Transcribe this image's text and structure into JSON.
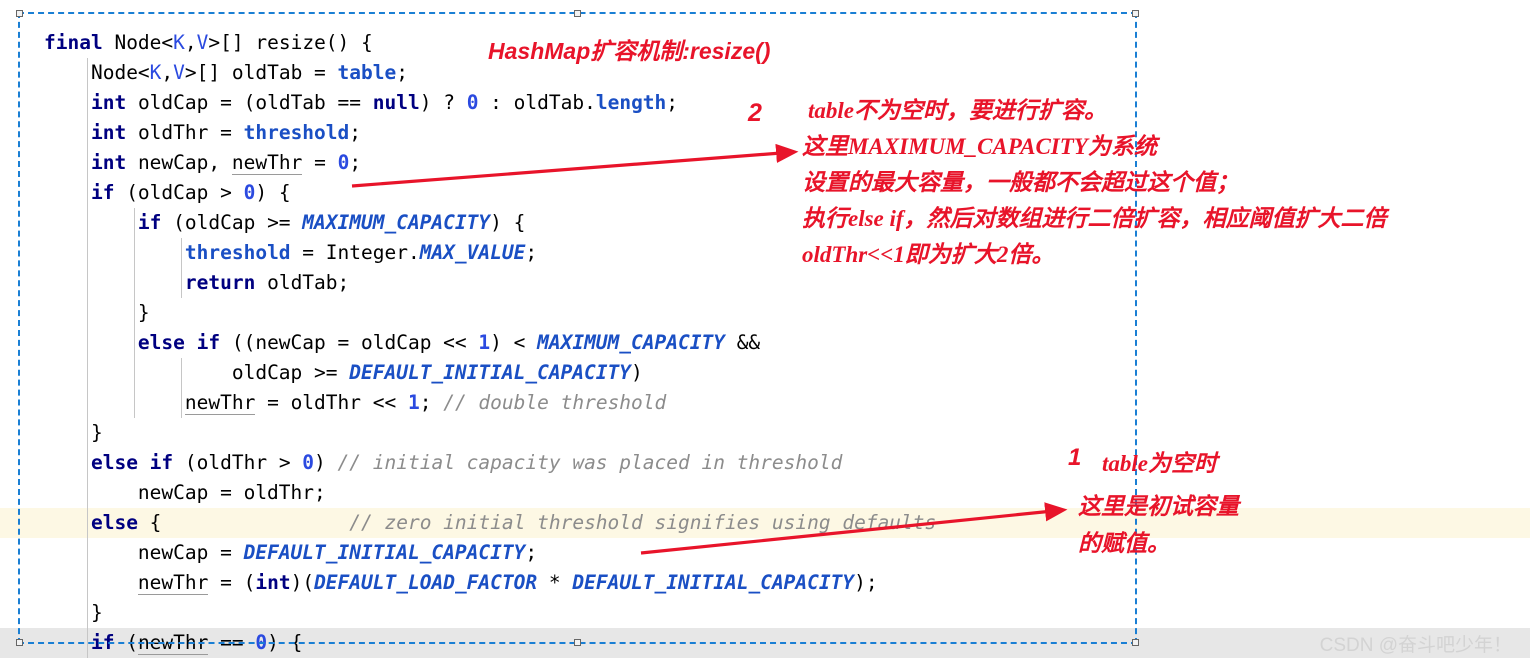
{
  "editor": {
    "language": "java",
    "selection_border_color": "#1a7fd4",
    "highlight_line_color": "#fdf8e4",
    "code_lines": [
      {
        "indent": 0,
        "tokens": [
          {
            "t": "final",
            "c": "kw"
          },
          {
            "t": " ",
            "c": "plain"
          },
          {
            "t": "Node<",
            "c": "plain"
          },
          {
            "t": "K",
            "c": "gen"
          },
          {
            "t": ",",
            "c": "plain"
          },
          {
            "t": "V",
            "c": "gen"
          },
          {
            "t": ">[] resize() {",
            "c": "plain"
          }
        ]
      },
      {
        "indent": 1,
        "tokens": [
          {
            "t": "Node<",
            "c": "plain"
          },
          {
            "t": "K",
            "c": "gen"
          },
          {
            "t": ",",
            "c": "plain"
          },
          {
            "t": "V",
            "c": "gen"
          },
          {
            "t": ">[] oldTab = ",
            "c": "plain"
          },
          {
            "t": "table",
            "c": "field"
          },
          {
            "t": ";",
            "c": "plain"
          }
        ]
      },
      {
        "indent": 1,
        "tokens": [
          {
            "t": "int",
            "c": "kw"
          },
          {
            "t": " oldCap = (oldTab == ",
            "c": "plain"
          },
          {
            "t": "null",
            "c": "kw"
          },
          {
            "t": ") ? ",
            "c": "plain"
          },
          {
            "t": "0",
            "c": "num"
          },
          {
            "t": " : oldTab.",
            "c": "plain"
          },
          {
            "t": "length",
            "c": "field"
          },
          {
            "t": ";",
            "c": "plain"
          }
        ]
      },
      {
        "indent": 1,
        "tokens": [
          {
            "t": "int",
            "c": "kw"
          },
          {
            "t": " oldThr = ",
            "c": "plain"
          },
          {
            "t": "threshold",
            "c": "field"
          },
          {
            "t": ";",
            "c": "plain"
          }
        ]
      },
      {
        "indent": 1,
        "tokens": [
          {
            "t": "int",
            "c": "kw"
          },
          {
            "t": " newCap, ",
            "c": "plain"
          },
          {
            "t": "newThr",
            "c": "warnvar"
          },
          {
            "t": " = ",
            "c": "plain"
          },
          {
            "t": "0",
            "c": "num"
          },
          {
            "t": ";",
            "c": "plain"
          }
        ]
      },
      {
        "indent": 1,
        "tokens": [
          {
            "t": "if",
            "c": "kw"
          },
          {
            "t": " (oldCap > ",
            "c": "plain"
          },
          {
            "t": "0",
            "c": "num"
          },
          {
            "t": ") {",
            "c": "plain"
          }
        ]
      },
      {
        "indent": 2,
        "tokens": [
          {
            "t": "if",
            "c": "kw"
          },
          {
            "t": " (oldCap >= ",
            "c": "plain"
          },
          {
            "t": "MAXIMUM_CAPACITY",
            "c": "const"
          },
          {
            "t": ") {",
            "c": "plain"
          }
        ]
      },
      {
        "indent": 3,
        "tokens": [
          {
            "t": "threshold",
            "c": "field"
          },
          {
            "t": " = Integer.",
            "c": "plain"
          },
          {
            "t": "MAX_VALUE",
            "c": "const"
          },
          {
            "t": ";",
            "c": "plain"
          }
        ]
      },
      {
        "indent": 3,
        "tokens": [
          {
            "t": "return",
            "c": "kw"
          },
          {
            "t": " oldTab;",
            "c": "plain"
          }
        ]
      },
      {
        "indent": 2,
        "tokens": [
          {
            "t": "}",
            "c": "plain"
          }
        ]
      },
      {
        "indent": 2,
        "tokens": [
          {
            "t": "else if",
            "c": "kw"
          },
          {
            "t": " ((newCap = oldCap << ",
            "c": "plain"
          },
          {
            "t": "1",
            "c": "num"
          },
          {
            "t": ") < ",
            "c": "plain"
          },
          {
            "t": "MAXIMUM_CAPACITY",
            "c": "const"
          },
          {
            "t": " &&",
            "c": "plain"
          }
        ]
      },
      {
        "indent": 4,
        "tokens": [
          {
            "t": "oldCap >= ",
            "c": "plain"
          },
          {
            "t": "DEFAULT_INITIAL_CAPACITY",
            "c": "const"
          },
          {
            "t": ")",
            "c": "plain"
          }
        ]
      },
      {
        "indent": 3,
        "tokens": [
          {
            "t": "newThr",
            "c": "warnvar"
          },
          {
            "t": " = oldThr << ",
            "c": "plain"
          },
          {
            "t": "1",
            "c": "num"
          },
          {
            "t": "; ",
            "c": "plain"
          },
          {
            "t": "// double threshold",
            "c": "cmt"
          }
        ]
      },
      {
        "indent": 1,
        "tokens": [
          {
            "t": "}",
            "c": "plain"
          }
        ]
      },
      {
        "indent": 1,
        "tokens": [
          {
            "t": "else if",
            "c": "kw"
          },
          {
            "t": " (oldThr > ",
            "c": "plain"
          },
          {
            "t": "0",
            "c": "num"
          },
          {
            "t": ") ",
            "c": "plain"
          },
          {
            "t": "// initial capacity was placed in threshold",
            "c": "cmt"
          }
        ]
      },
      {
        "indent": 2,
        "tokens": [
          {
            "t": "newCap = oldThr;",
            "c": "plain"
          }
        ]
      },
      {
        "indent": 1,
        "highlight": true,
        "tokens": [
          {
            "t": "else",
            "c": "kw"
          },
          {
            "t": " {                ",
            "c": "plain"
          },
          {
            "t": "// zero initial threshold signifies using defaults",
            "c": "cmt"
          }
        ]
      },
      {
        "indent": 2,
        "tokens": [
          {
            "t": "newCap = ",
            "c": "plain"
          },
          {
            "t": "DEFAULT_INITIAL_CAPACITY",
            "c": "const"
          },
          {
            "t": ";",
            "c": "plain"
          }
        ]
      },
      {
        "indent": 2,
        "tokens": [
          {
            "t": "newThr",
            "c": "warnvar"
          },
          {
            "t": " = (",
            "c": "plain"
          },
          {
            "t": "int",
            "c": "kw"
          },
          {
            "t": ")(",
            "c": "plain"
          },
          {
            "t": "DEFAULT_LOAD_FACTOR",
            "c": "const"
          },
          {
            "t": " * ",
            "c": "plain"
          },
          {
            "t": "DEFAULT_INITIAL_CAPACITY",
            "c": "const"
          },
          {
            "t": ");",
            "c": "plain"
          }
        ]
      },
      {
        "indent": 1,
        "tokens": [
          {
            "t": "}",
            "c": "plain"
          }
        ]
      },
      {
        "indent": 1,
        "band": true,
        "tokens": [
          {
            "t": "if",
            "c": "kw"
          },
          {
            "t": " (",
            "c": "plain"
          },
          {
            "t": "newThr",
            "c": "warnvar"
          },
          {
            "t": " == ",
            "c": "plain"
          },
          {
            "t": "0",
            "c": "num"
          },
          {
            "t": ") {",
            "c": "plain"
          }
        ]
      }
    ]
  },
  "annotations": {
    "color": "#e8142a",
    "title": "HashMap扩容机制:resize()",
    "marker_2": "2",
    "right_line1": "table不为空时，要进行扩容。",
    "right_line2": "这里MAXIMUM_CAPACITY为系统",
    "right_line3": "设置的最大容量，一般都不会超过这个值；",
    "right_line4": "执行else if，然后对数组进行二倍扩容，相应阈值扩大二倍",
    "right_line5": "oldThr<<1即为扩大2倍。",
    "marker_1": "1",
    "bottom_line1": "table为空时",
    "bottom_line2": "这里是初试容量",
    "bottom_line3": "的赋值。"
  },
  "watermark": {
    "text": "CSDN @奋斗吧少年！"
  }
}
